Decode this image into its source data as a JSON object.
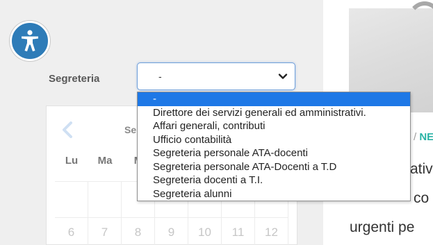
{
  "filter": {
    "label": "Segreteria",
    "selected_value": "-",
    "options": [
      "-",
      "Direttore dei servizi generali ed amministrativi.",
      "Affari generali, contributi",
      "Ufficio contabilità",
      "Segreteria personale ATA-docenti",
      "Segreteria personale ATA-Docenti a T.D",
      "Segreteria docenti a T.I.",
      "Segreteria alunni"
    ]
  },
  "calendar": {
    "month_partial": "Se",
    "weekdays": [
      "Lu",
      "Ma",
      "M"
    ],
    "row_partial": [
      "",
      "",
      "",
      "",
      "",
      "",
      ""
    ],
    "days": [
      "6",
      "7",
      "8",
      "9",
      "10",
      "11",
      "12"
    ]
  },
  "article": {
    "breadcrumb_sep": "/",
    "breadcrumb_tag": "NE",
    "lines": [
      "ativ",
      "co",
      "urgenti pe"
    ]
  },
  "colors": {
    "accessibility_button": "#2e7cb8",
    "dropdown_selected": "#1e78e6",
    "breadcrumb_tag": "#2ab3a6"
  },
  "icons": {
    "accessibility": "accessibility-icon",
    "select_arrow": "chevron-down-icon",
    "calendar_prev": "chevron-left-icon"
  }
}
